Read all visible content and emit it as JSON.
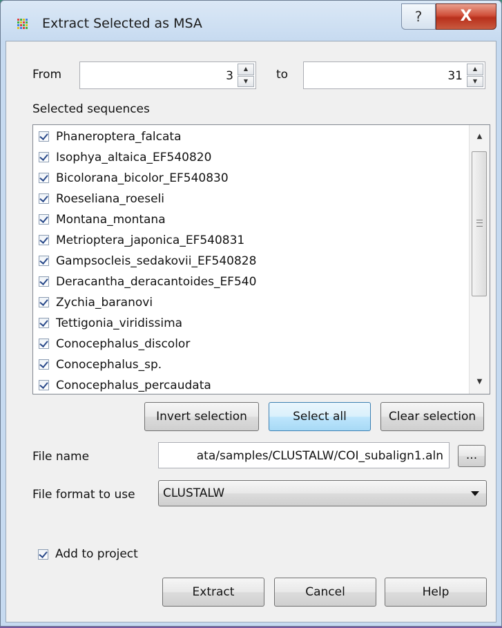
{
  "window": {
    "title": "Extract Selected as MSA",
    "help_label": "?",
    "close_label": "X"
  },
  "range": {
    "from_label": "From",
    "from_value": "3",
    "to_label": "to",
    "to_value": "31"
  },
  "sequences": {
    "label": "Selected sequences",
    "items": [
      "Phaneroptera_falcata",
      "Isophya_altaica_EF540820",
      "Bicolorana_bicolor_EF540830",
      "Roeseliana_roeseli",
      "Montana_montana",
      "Metrioptera_japonica_EF540831",
      "Gampsocleis_sedakovii_EF540828",
      "Deracantha_deracantoides_EF540",
      "Zychia_baranovi",
      "Tettigonia_viridissima",
      "Conocephalus_discolor",
      "Conocephalus_sp.",
      "Conocephalus_percaudata"
    ]
  },
  "buttons": {
    "invert": "Invert selection",
    "select_all": "Select all",
    "clear": "Clear selection",
    "browse": "...",
    "extract": "Extract",
    "cancel": "Cancel",
    "help": "Help"
  },
  "file": {
    "name_label": "File name",
    "name_value": "ata/samples/CLUSTALW/COI_subalign1.aln",
    "format_label": "File format to use",
    "format_value": "CLUSTALW"
  },
  "options": {
    "add_to_project": "Add to project"
  }
}
